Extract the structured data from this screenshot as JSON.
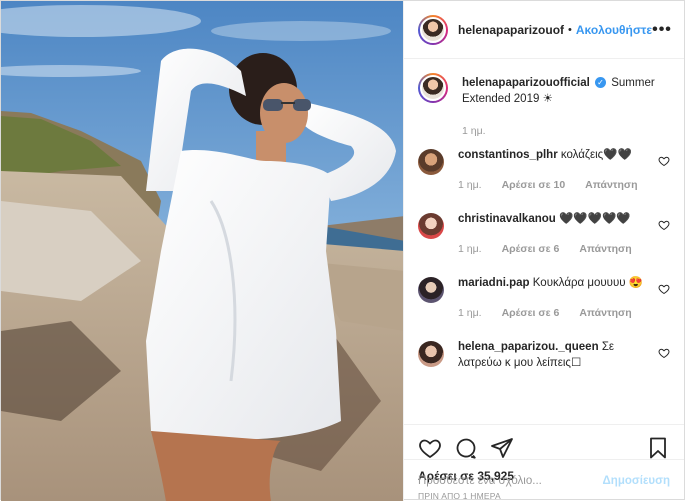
{
  "header": {
    "username": "helenapaparizouof",
    "separator": "•",
    "follow_label": "Ακολουθήστε",
    "more_icon": "ellipsis-icon",
    "more_label": "•••"
  },
  "caption": {
    "username": "helenapaparizouofficial",
    "verified_glyph": "✓",
    "text": "Summer Extended 2019 ☀",
    "time": "1 ημ."
  },
  "comments": [
    {
      "username": "constantinos_plhr",
      "text": "κολάζεις🖤🖤",
      "time": "1 ημ.",
      "likes": "Αρέσει σε 10",
      "reply": "Απάντηση"
    },
    {
      "username": "christinavalkanou",
      "text": "🖤🖤🖤🖤🖤",
      "time": "1 ημ.",
      "likes": "Αρέσει σε 6",
      "reply": "Απάντηση"
    },
    {
      "username": "mariadni.pap",
      "text": "Κουκλάρα μουυυυ 😍",
      "time": "1 ημ.",
      "likes": "Αρέσει σε 6",
      "reply": "Απάντηση"
    },
    {
      "username": "helena_paparizou._queen",
      "text": "Σε λατρεύω κ μου λείπεις☐"
    }
  ],
  "actions": {
    "likes_text": "Αρέσει σε 35,925",
    "timestamp": "ΠΡΙΝ ΑΠΟ 1 ΗΜΕΡΑ"
  },
  "add_comment": {
    "placeholder": "Προσθέστε ένα σχόλιο...",
    "post_label": "Δημοσίευση"
  },
  "colors": {
    "accent": "#3897f0",
    "post_disabled": "#b2dffc",
    "muted": "#999999",
    "text": "#262626"
  }
}
